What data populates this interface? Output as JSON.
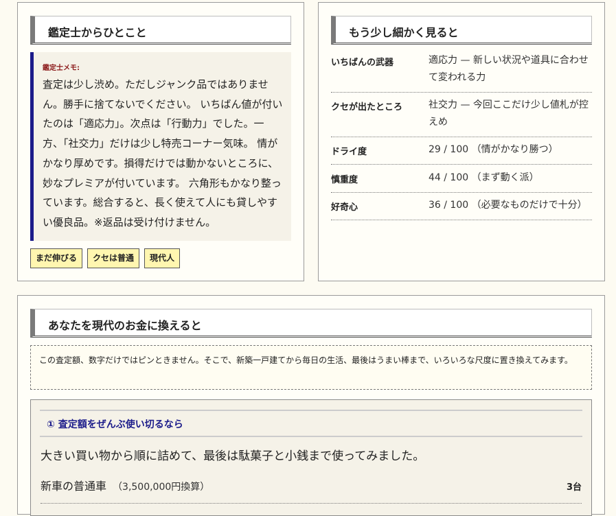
{
  "appraiser": {
    "title": "鑑定士からひとこと",
    "memo_label": "鑑定士メモ:",
    "memo_text": "査定は少し渋め。ただしジャンク品ではありません。勝手に捨てないでください。 いちばん値が付いたのは「適応力」。次点は「行動力」でした。一方、「社交力」だけは少し特売コーナー気味。 情がかなり厚めです。損得だけでは動かないところに、妙なプレミアが付いています。 六角形もかなり整っています。総合すると、長く使えて人にも貸しやすい優良品。※返品は受け付けません。",
    "tags": [
      "まだ伸びる",
      "クセは普通",
      "現代人"
    ]
  },
  "details": {
    "title": "もう少し細かく見ると",
    "rows": [
      {
        "label": "いちばんの武器",
        "value": "適応力 — 新しい状況や道具に合わせて変われる力"
      },
      {
        "label": "クセが出たところ",
        "value": "社交力 — 今回ここだけ少し値札が控えめ"
      },
      {
        "label": "ドライ度",
        "value": "29 / 100 （情がかなり勝つ）"
      },
      {
        "label": "慎重度",
        "value": "44 / 100 （まず動く派）"
      },
      {
        "label": "好奇心",
        "value": "36 / 100 （必要なものだけで十分）"
      }
    ]
  },
  "money": {
    "title": "あなたを現代のお金に換えると",
    "note": "この査定額、数字だけではピンときません。そこで、新築一戸建てから毎日の生活、最後はうまい棒まで、いろいろな尺度に置き換えてみます。",
    "panel": {
      "heading": "① 査定額をぜんぶ使い切るなら",
      "lead": "大きい買い物から順に詰めて、最後は駄菓子と小銭まで使ってみました。",
      "item_label": "新車の普通車",
      "item_sub": "（3,500,000円換算）",
      "item_count": "3台"
    }
  }
}
